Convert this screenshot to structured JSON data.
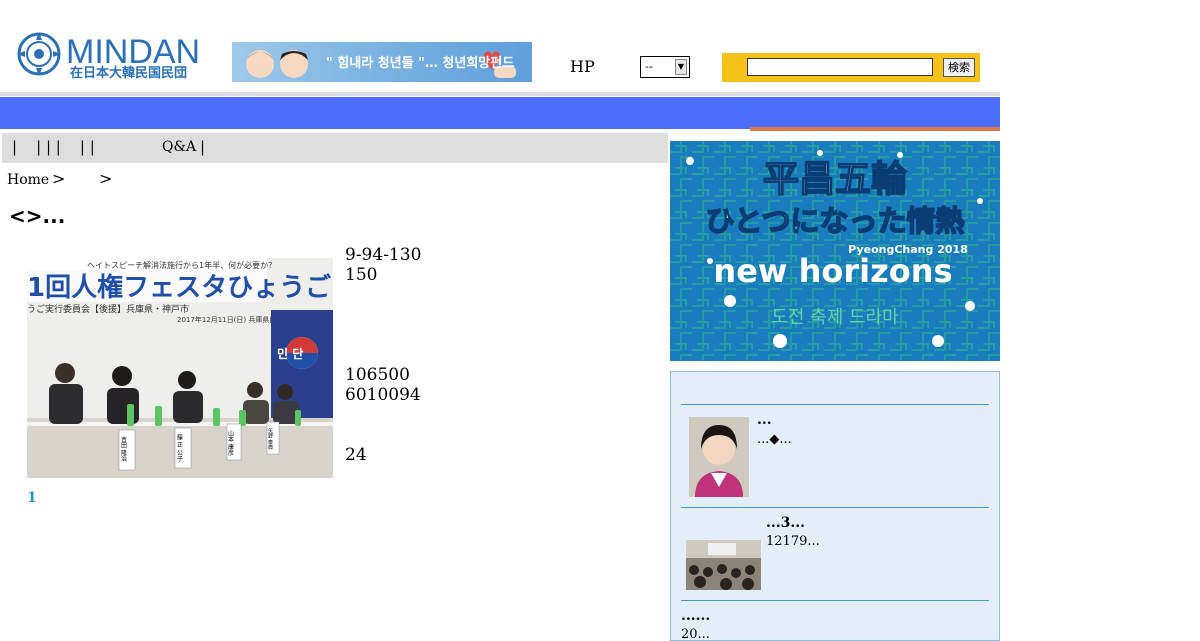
{
  "header": {
    "logo": {
      "brand": "MINDAN",
      "subtitle": "在日本大韓民国民団"
    },
    "banner": {
      "text": "\" 힘내라 청년들 \"… 청년희망펀드"
    },
    "hp_label": "HP",
    "hp_select": {
      "value": "--"
    },
    "search": {
      "placeholder": "",
      "button_label": "検索"
    }
  },
  "menu": {
    "pipes": "|    | | |    | |    ",
    "qa": "Q&A",
    "end_pipe": "|"
  },
  "breadcrumb": {
    "home": "Home",
    "sep": ">"
  },
  "article": {
    "title": "<>...",
    "photo": {
      "banner_text": "1回人権フェスタひょうご",
      "top_text": "ヘイトスピーチ解消法施行から1年半、何が必要か？",
      "org_text": "うご実行委員会【後援】兵庫県・神戸市",
      "date_text": "2017年12月11日(日) 兵庫県民会館",
      "flag_text": "민 단",
      "nameplates": [
        "吉田 隆治",
        "藤 正 公子",
        "山本 康彦",
        "矢野 泰典"
      ]
    },
    "lines": [
      "9-94-130",
      "150",
      "",
      "",
      "",
      "",
      "106500",
      "6010094",
      "",
      "",
      "24"
    ],
    "page": "1"
  },
  "sidebar": {
    "banner": {
      "line1": "平昌五輪",
      "line2": "ひとつになった情熱",
      "city": "PyeongChang 2018",
      "slogan": "new horizons",
      "hangul": "도전 축제 드라마"
    },
    "news": [
      {
        "title": "...",
        "summary": "...◆..."
      },
      {
        "title": "...3...",
        "summary": "12179..."
      },
      {
        "title": "......",
        "summary": "20..."
      }
    ]
  },
  "colors": {
    "nav_blue": "#4a6dfb",
    "accent_orange": "#e0754a",
    "search_yellow": "#f5c21a",
    "link_blue": "#2196c8"
  }
}
